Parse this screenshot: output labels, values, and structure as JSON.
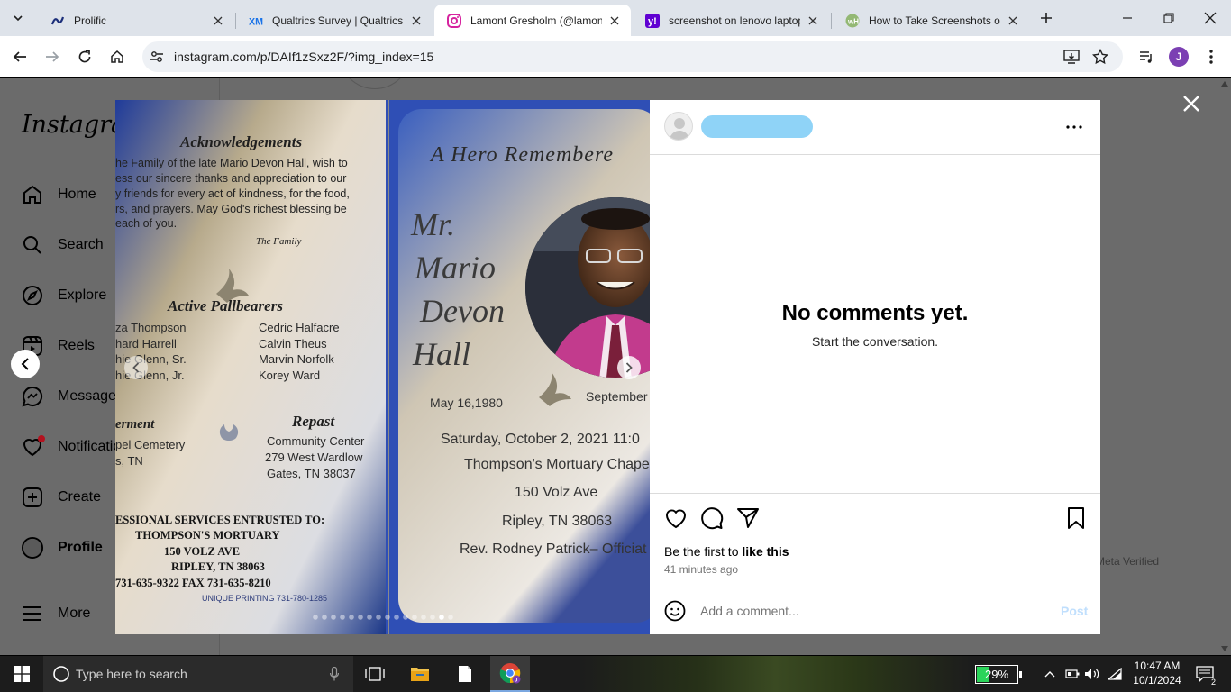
{
  "browser": {
    "tabs": [
      {
        "title": "Prolific",
        "icon": "prolific-icon"
      },
      {
        "title": "Qualtrics Survey | Qualtrics E",
        "icon": "qualtrics-icon"
      },
      {
        "title": "Lamont Gresholm (@lamont",
        "icon": "instagram-icon"
      },
      {
        "title": "screenshot on lenovo laptop",
        "icon": "yahoo-icon"
      },
      {
        "title": "How to Take Screenshots on",
        "icon": "wikihow-icon"
      }
    ],
    "url": "instagram.com/p/DAIf1zSxz2F/?img_index=15"
  },
  "instagram": {
    "logo": "Instagram",
    "nav": [
      {
        "label": "Home",
        "icon": "home-icon"
      },
      {
        "label": "Search",
        "icon": "search-icon"
      },
      {
        "label": "Explore",
        "icon": "explore-icon"
      },
      {
        "label": "Reels",
        "icon": "reels-icon"
      },
      {
        "label": "Messages",
        "icon": "messages-icon"
      },
      {
        "label": "Notifications",
        "icon": "heart-icon"
      },
      {
        "label": "Create",
        "icon": "create-icon"
      },
      {
        "label": "Profile",
        "icon": "profile-icon"
      },
      {
        "label": "More",
        "icon": "menu-icon"
      }
    ],
    "background_text": "Meta Verified"
  },
  "post": {
    "no_comments_title": "No comments yet.",
    "no_comments_subtitle": "Start the conversation.",
    "likes_prefix": "Be the first to ",
    "likes_link": "like this",
    "time": "41 minutes ago",
    "comment_placeholder": "Add a comment...",
    "post_button": "Post",
    "carousel": {
      "total": 16,
      "current": 15
    }
  },
  "program": {
    "acknowledgements": {
      "heading": "Acknowledgements",
      "lines": [
        "he Family of the late Mario Devon Hall, wish to",
        "ess our sincere thanks and appreciation to our",
        "y friends for every act of kindness, for the food,",
        "rs, and prayers. May God's richest blessing be",
        "each of you."
      ],
      "signature": "The Family"
    },
    "pallbearers": {
      "heading": "Active Pallbearers",
      "left": [
        "za Thompson",
        "hard Harrell",
        "hie Glenn, Sr.",
        "hie Glenn, Jr."
      ],
      "right": [
        "Cedric Halfacre",
        "Calvin Theus",
        "Marvin Norfolk",
        "Korey Ward"
      ]
    },
    "interment": {
      "heading": "erment",
      "lines": [
        "pel Cemetery",
        "s, TN"
      ]
    },
    "repast": {
      "heading": "Repast",
      "lines": [
        "Community Center",
        "279 West Wardlow",
        "Gates, TN  38037"
      ]
    },
    "services": {
      "lines": [
        "ESSIONAL SERVICES ENTRUSTED TO:",
        "THOMPSON'S MORTUARY",
        "150 VOLZ AVE",
        "RIPLEY, TN 38063",
        "731-635-9322   FAX 731-635-8210"
      ],
      "printer": "UNIQUE PRINTING   731-780-1285"
    },
    "cover": {
      "title": "A Hero Remembere",
      "name_lines": [
        "Mr.",
        "Mario",
        "Devon",
        "Hall"
      ],
      "born": "May 16,1980",
      "died": "September",
      "service_lines": [
        "Saturday, October 2, 2021 11:0",
        "Thompson's Mortuary Chape",
        "150 Volz Ave",
        "Ripley, TN 38063",
        "Rev. Rodney Patrick– Officiat"
      ]
    }
  },
  "taskbar": {
    "search_placeholder": "Type here to search",
    "battery": "29%",
    "time": "10:47 AM",
    "date": "10/1/2024",
    "notification_count": "2"
  }
}
